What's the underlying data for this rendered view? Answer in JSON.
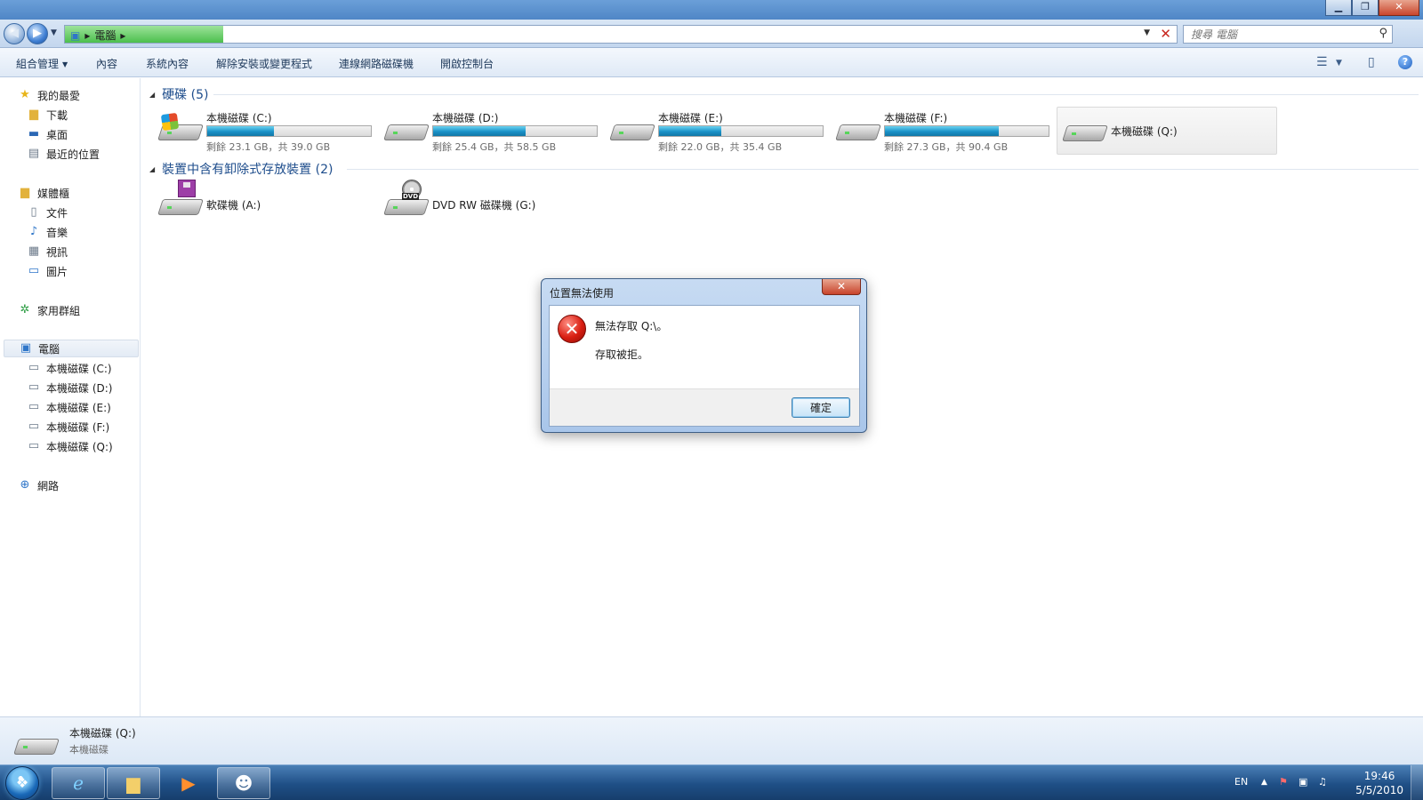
{
  "window": {
    "title": "",
    "controls": {
      "minimize": "▁",
      "restore": "❐",
      "close": "✕"
    }
  },
  "nav": {
    "back_glyph": "◀",
    "forward_glyph": "▶",
    "address_segment": "電腦",
    "address_sep": "▸",
    "dropdown_glyph": "▼",
    "stop_glyph": "✕",
    "search_placeholder": "搜尋 電腦",
    "search_glyph": "⚲"
  },
  "commands": {
    "organize": "組合管理",
    "properties": "內容",
    "system_properties": "系統內容",
    "uninstall": "解除安裝或變更程式",
    "map_drive": "連線網路磁碟機",
    "control_panel": "開啟控制台",
    "views_glyph": "☰",
    "views_caret": "▼",
    "preview_glyph": "▯",
    "help_glyph": "?"
  },
  "sidebar": {
    "favorites": "我的最愛",
    "downloads": "下載",
    "desktop": "桌面",
    "recent": "最近的位置",
    "libraries": "媒體櫃",
    "documents": "文件",
    "music": "音樂",
    "videos": "視訊",
    "pictures": "圖片",
    "homegroup": "家用群組",
    "computer": "電腦",
    "drive_c": "本機磁碟 (C:)",
    "drive_d": "本機磁碟 (D:)",
    "drive_e": "本機磁碟 (E:)",
    "drive_f": "本機磁碟 (F:)",
    "drive_q": "本機磁碟 (Q:)",
    "network": "網路"
  },
  "content": {
    "group_hdd": "硬碟 (5)",
    "group_removable": "裝置中含有卸除式存放裝置 (2)",
    "drives": [
      {
        "name": "本機磁碟 (C:)",
        "size": "剩餘 23.1 GB，共 39.0 GB",
        "used_fraction": 0.408
      },
      {
        "name": "本機磁碟 (D:)",
        "size": "剩餘 25.4 GB，共 58.5 GB",
        "used_fraction": 0.566
      },
      {
        "name": "本機磁碟 (E:)",
        "size": "剩餘 22.0 GB，共 35.4 GB",
        "used_fraction": 0.379
      },
      {
        "name": "本機磁碟 (F:)",
        "size": "剩餘 27.3 GB，共 90.4 GB",
        "used_fraction": 0.698
      },
      {
        "name": "本機磁碟 (Q:)"
      }
    ],
    "removable": [
      {
        "name": "軟碟機 (A:)"
      },
      {
        "name": "DVD RW 磁碟機 (G:)",
        "badge": "DVD"
      }
    ]
  },
  "dialog": {
    "title": "位置無法使用",
    "close_glyph": "✕",
    "icon_glyph": "✕",
    "message1": "無法存取 Q:\\。",
    "message2": "存取被拒。",
    "ok": "確定"
  },
  "details": {
    "name": "本機磁碟 (Q:)",
    "type": "本機磁碟"
  },
  "taskbar": {
    "start_glyph": "❖",
    "language": "EN",
    "tray_up": "▲",
    "time": "19:46",
    "date": "5/5/2010"
  },
  "colors": {
    "accent": "#1e4d8c",
    "bar_fill": "#1a91c7",
    "error": "#d91e12"
  }
}
